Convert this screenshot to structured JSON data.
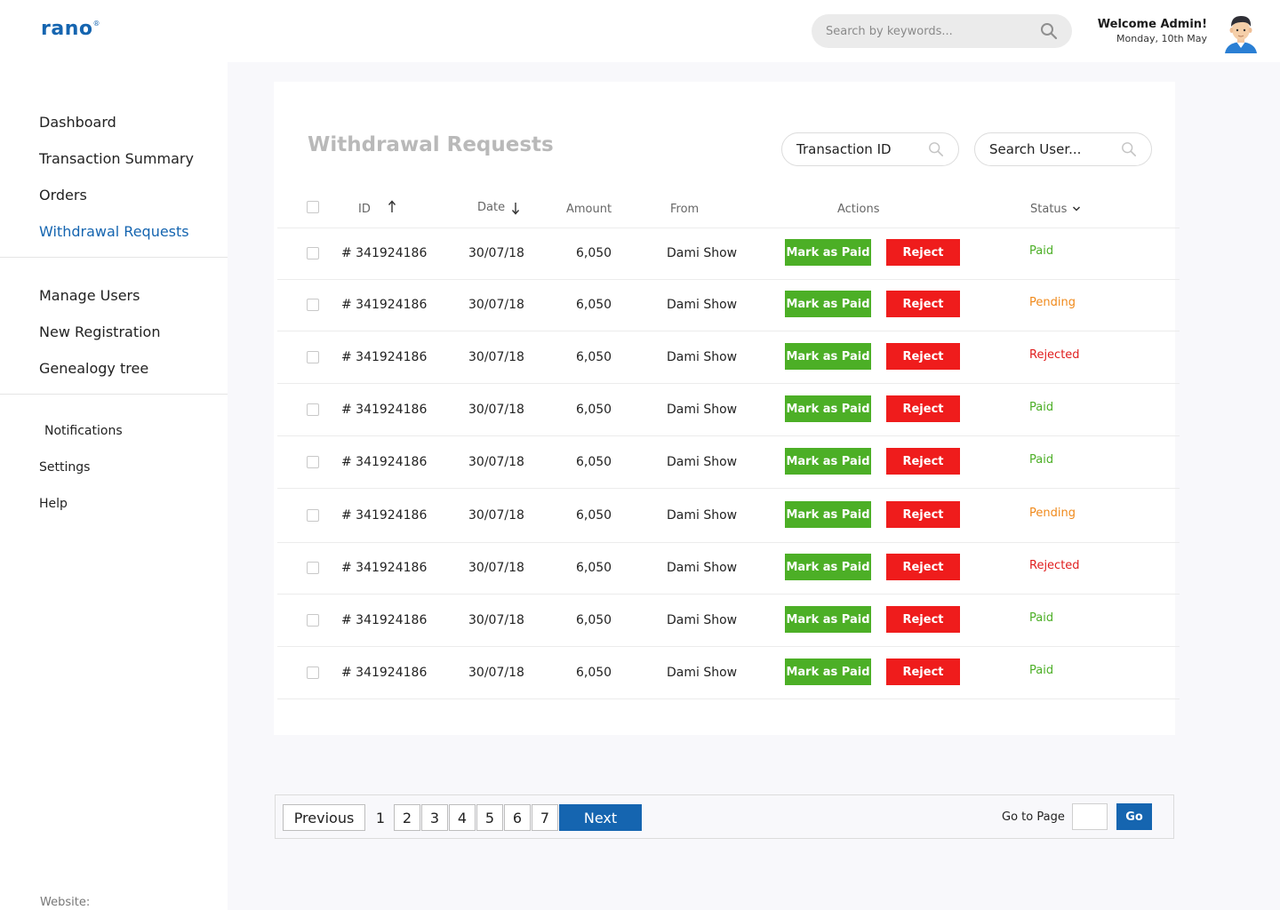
{
  "header": {
    "logo": "rano",
    "logo_mark": "®",
    "search_placeholder": "Search by keywords...",
    "search_icon": "search-icon",
    "welcome": "Welcome Admin!",
    "date": "Monday, 10th May"
  },
  "sidebar": {
    "items": [
      {
        "label": "Dashboard"
      },
      {
        "label": "Transaction Summary"
      },
      {
        "label": "Orders"
      },
      {
        "label": "Withdrawal Requests"
      },
      {
        "label": "Manage Users"
      },
      {
        "label": "New Registration"
      },
      {
        "label": "Genealogy tree"
      },
      {
        "label": "Notifications"
      },
      {
        "label": "Settings"
      },
      {
        "label": "Help"
      }
    ],
    "active": "Withdrawal Requests",
    "footer": "Website:"
  },
  "page": {
    "title": "Withdrawal Requests",
    "transaction_search": "Transaction ID",
    "user_search": "Search User..."
  },
  "table": {
    "columns": {
      "id": "ID",
      "date": "Date",
      "amount": "Amount",
      "from": "From",
      "actions": "Actions",
      "status": "Status"
    },
    "mark_paid_label": "Mark as Paid",
    "reject_label": "Reject",
    "rows": [
      {
        "id": "# 341924186",
        "date": "30/07/18",
        "amount": "6,050",
        "from": "Dami Show",
        "status": "Paid"
      },
      {
        "id": "# 341924186",
        "date": "30/07/18",
        "amount": "6,050",
        "from": "Dami Show",
        "status": "Pending"
      },
      {
        "id": "# 341924186",
        "date": "30/07/18",
        "amount": "6,050",
        "from": "Dami Show",
        "status": "Rejected"
      },
      {
        "id": "# 341924186",
        "date": "30/07/18",
        "amount": "6,050",
        "from": "Dami Show",
        "status": "Paid"
      },
      {
        "id": "# 341924186",
        "date": "30/07/18",
        "amount": "6,050",
        "from": "Dami Show",
        "status": "Paid"
      },
      {
        "id": "# 341924186",
        "date": "30/07/18",
        "amount": "6,050",
        "from": "Dami Show",
        "status": "Pending"
      },
      {
        "id": "# 341924186",
        "date": "30/07/18",
        "amount": "6,050",
        "from": "Dami Show",
        "status": "Rejected"
      },
      {
        "id": "# 341924186",
        "date": "30/07/18",
        "amount": "6,050",
        "from": "Dami Show",
        "status": "Paid"
      },
      {
        "id": "# 341924186",
        "date": "30/07/18",
        "amount": "6,050",
        "from": "Dami Show",
        "status": "Paid"
      }
    ]
  },
  "pagination": {
    "previous": "Previous",
    "pages": [
      "1",
      "2",
      "3",
      "4",
      "5",
      "6",
      "7"
    ],
    "next": "Next",
    "goto_label": "Go to Page",
    "go": "Go"
  },
  "colors": {
    "brand": "#1565b0",
    "paid": "#4caf26",
    "pending": "#f08a1c",
    "rejected": "#e01e1e",
    "reject_button": "#ef1c1c"
  }
}
